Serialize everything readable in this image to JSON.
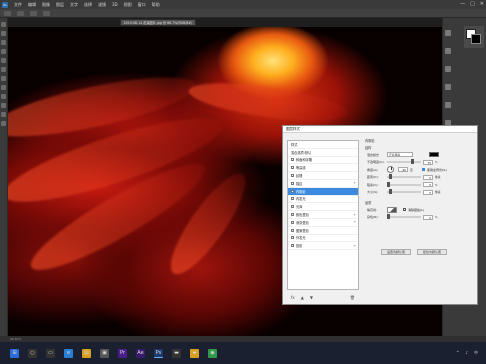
{
  "app": {
    "document_tab": "2019-08-14 花朵图片.jpg @ 66.7%(RGB/8#)"
  },
  "menubar": {
    "logo": "Ps",
    "items": [
      "文件",
      "编辑",
      "图像",
      "图层",
      "文字",
      "选择",
      "滤镜",
      "3D",
      "视图",
      "窗口",
      "帮助"
    ],
    "window_controls": [
      "—",
      "□",
      "✕"
    ]
  },
  "layer_style_dialog": {
    "title": "图层样式",
    "list": [
      {
        "label": "样式",
        "checked": null,
        "plus": false,
        "selected": false
      },
      {
        "label": "混合选项:默认",
        "checked": null,
        "plus": false,
        "selected": false
      },
      {
        "label": "斜面和浮雕",
        "checked": false,
        "plus": false,
        "selected": false
      },
      {
        "label": "等高线",
        "checked": false,
        "plus": false,
        "selected": false
      },
      {
        "label": "纹理",
        "checked": false,
        "plus": false,
        "selected": false
      },
      {
        "label": "描边",
        "checked": false,
        "plus": true,
        "selected": false
      },
      {
        "label": "内阴影",
        "checked": true,
        "plus": true,
        "selected": true
      },
      {
        "label": "内发光",
        "checked": false,
        "plus": false,
        "selected": false
      },
      {
        "label": "光泽",
        "checked": false,
        "plus": false,
        "selected": false
      },
      {
        "label": "颜色叠加",
        "checked": false,
        "plus": true,
        "selected": false
      },
      {
        "label": "渐变叠加",
        "checked": false,
        "plus": true,
        "selected": false
      },
      {
        "label": "图案叠加",
        "checked": false,
        "plus": false,
        "selected": false
      },
      {
        "label": "外发光",
        "checked": false,
        "plus": false,
        "selected": false
      },
      {
        "label": "投影",
        "checked": false,
        "plus": true,
        "selected": false
      }
    ],
    "footer_icons": [
      "fx",
      "▲",
      "▼",
      "🗑"
    ],
    "settings": {
      "section_title": "内阴影",
      "structure_title": "结构",
      "blend_mode_label": "混合模式",
      "blend_mode_value": "正片叠底",
      "opacity_label": "不透明度(O):",
      "opacity_value": "75",
      "angle_label": "角度(A):",
      "angle_value": "90",
      "global_light_label": "使用全局光(G)",
      "distance_label": "距离(D):",
      "distance_value": "5",
      "choke_label": "阻塞(C):",
      "choke_value": "0",
      "size_label": "大小(S):",
      "size_value": "5",
      "quality_title": "品质",
      "contour_label": "等高线:",
      "antialias_label": "消除锯齿(L)",
      "noise_label": "杂色(N):",
      "noise_value": "0",
      "unit_percent": "%",
      "unit_px": "像素",
      "unit_deg": "度",
      "default_button": "设置为默认值",
      "reset_button": "复位为默认值",
      "shadow_color": "#000000"
    }
  },
  "colors": {
    "foreground": "#ffffff",
    "background": "#000000",
    "selection": "#3a8ae0"
  },
  "statusbar": {
    "text": "66.67%"
  },
  "taskbar": {
    "icons": [
      "windows-icon",
      "search-icon",
      "task-view-icon",
      "edge-icon",
      "explorer-icon",
      "store-icon",
      "premiere-icon",
      "after-effects-icon",
      "photoshop-icon",
      "terminal-icon",
      "folder-icon",
      "chrome-icon"
    ],
    "glyphs": [
      "⊞",
      "○",
      "▭",
      "e",
      "▤",
      "▣",
      "Pr",
      "Ae",
      "Ps",
      "▬",
      "▰",
      "◉"
    ],
    "active_index": 8,
    "tray": [
      "^",
      "♪",
      "中"
    ]
  }
}
